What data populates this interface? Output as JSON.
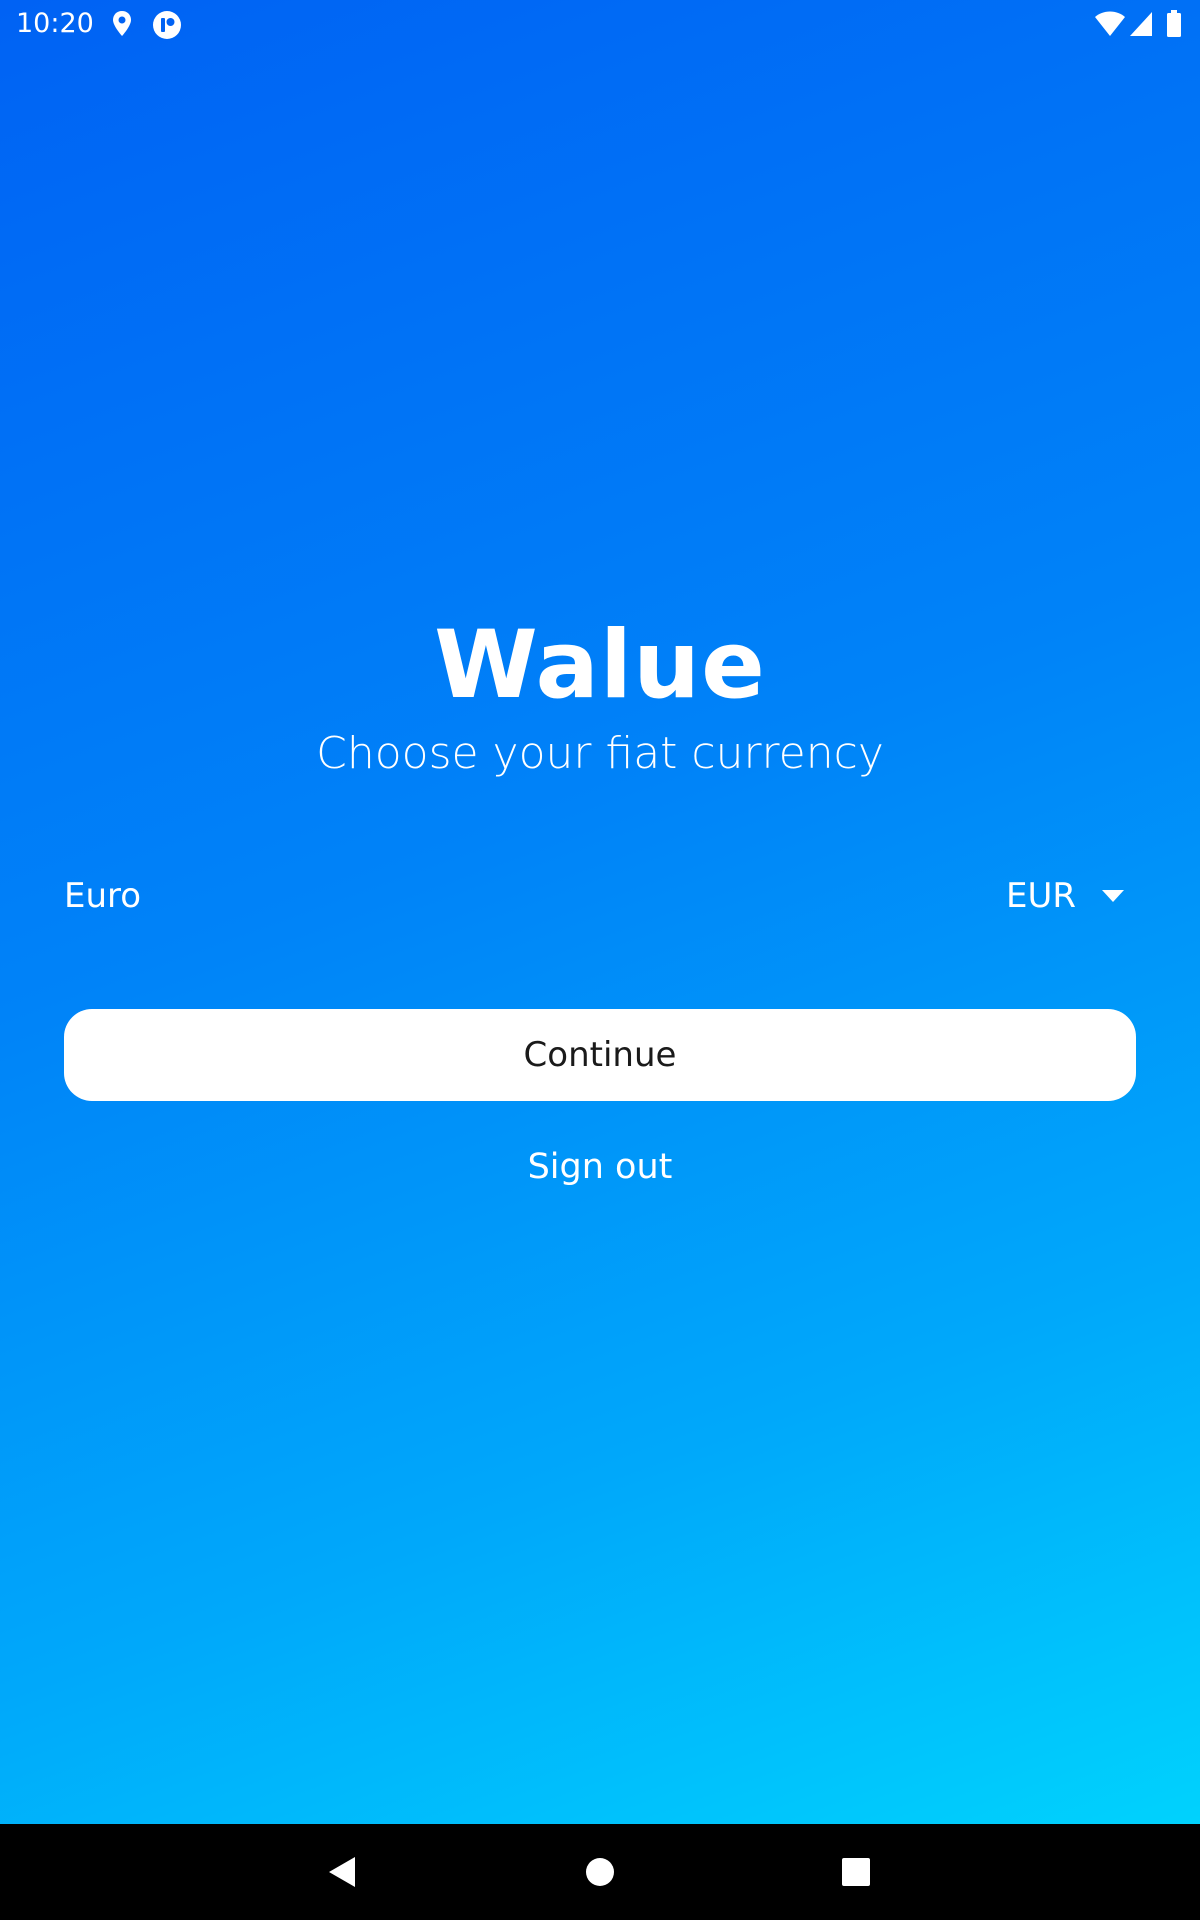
{
  "status_bar": {
    "time": "10:20",
    "icons_left": [
      "location-icon",
      "app-notification-icon"
    ],
    "icons_right": [
      "wifi-icon",
      "cellular-signal-icon",
      "battery-icon"
    ]
  },
  "app": {
    "logo": "Walue",
    "subtitle": "Choose your fiat currency"
  },
  "currency": {
    "name": "Euro",
    "code": "EUR"
  },
  "buttons": {
    "continue_label": "Continue",
    "signout_label": "Sign out"
  },
  "nav_bar": {
    "icons": [
      "back-icon",
      "home-icon",
      "recents-icon"
    ]
  },
  "colors": {
    "gradient_start": "#0062F4",
    "gradient_end": "#00D2FD",
    "button_bg": "#ffffff",
    "button_text": "#1a1a1a",
    "nav_bar_bg": "#000000"
  }
}
